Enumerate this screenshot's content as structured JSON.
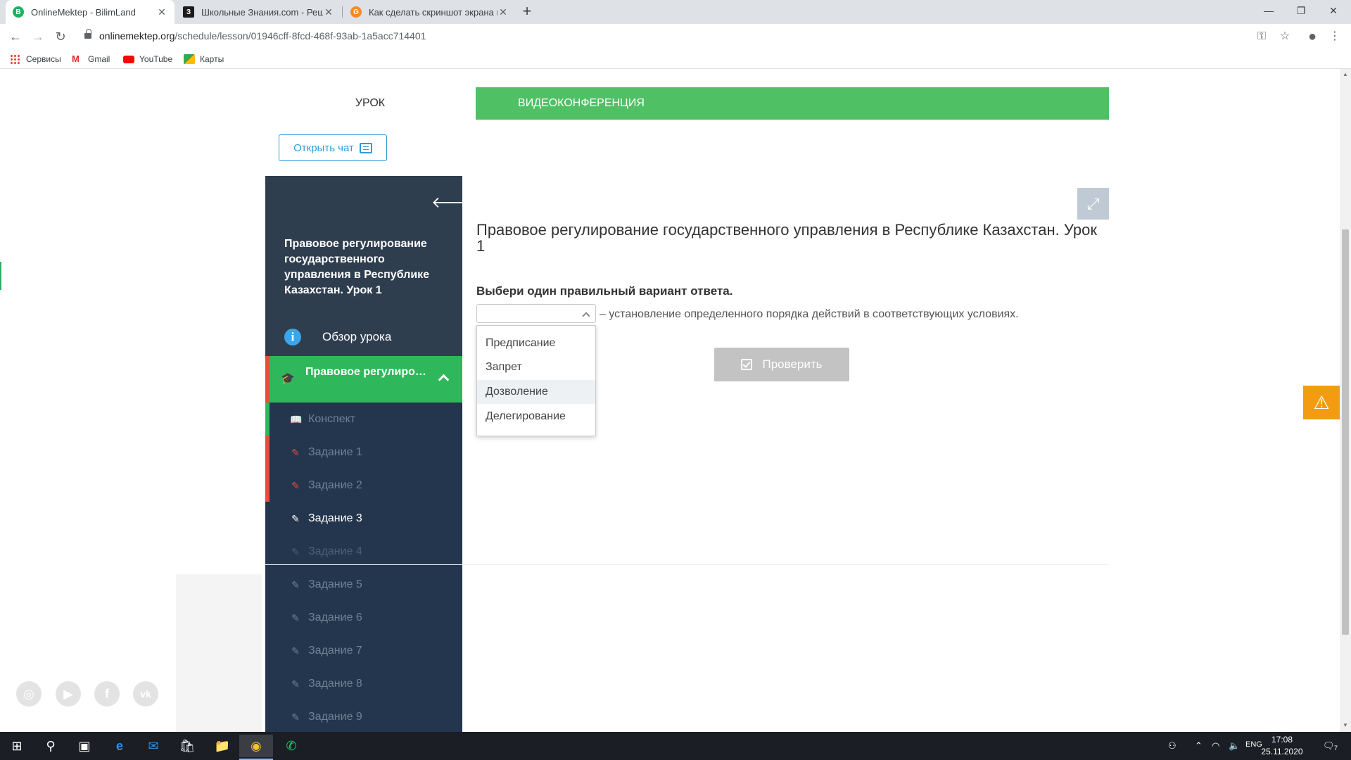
{
  "browser": {
    "tabs": [
      {
        "title": "OnlineMektep - BilimLand",
        "active": true,
        "favicon_color": "#27ae60",
        "favicon": "B"
      },
      {
        "title": "Школьные Знания.com - Решае",
        "active": false,
        "favicon_color": "#1b1b1b",
        "favicon": "З"
      },
      {
        "title": "Как сделать скриншот экрана н",
        "active": false,
        "favicon_color": "#f08c28",
        "favicon": "G"
      }
    ],
    "new_tab": "+",
    "url_domain": "onlinemektep.org",
    "url_path": "/schedule/lesson/01946cff-8fcd-468f-93ab-1a5acc714401",
    "bookmarks": [
      {
        "label": "Сервисы",
        "icon": "apps-grid-icon",
        "color": "#ea4335"
      },
      {
        "label": "Gmail",
        "icon": "gmail-icon",
        "color": "#d93025"
      },
      {
        "label": "YouTube",
        "icon": "youtube-icon",
        "color": "#ff0000"
      },
      {
        "label": "Карты",
        "icon": "maps-icon",
        "color": "#34a853"
      }
    ]
  },
  "lesson_tabs": {
    "lesson": "УРОК",
    "video": "ВИДЕОКОНФЕРЕНЦИЯ"
  },
  "chat_button": "Открыть чат",
  "sidebar": {
    "title": "Правовое регулирование государственного управления в Республике Казахстан. Урок 1",
    "overview": "Обзор урока",
    "section": "Правовое регулирование гос...",
    "items": [
      {
        "label": "Конспект",
        "state": "viewed",
        "icon": "book-icon"
      },
      {
        "label": "Задание 1",
        "state": "wrong",
        "icon": "edit-icon"
      },
      {
        "label": "Задание 2",
        "state": "wrong",
        "icon": "edit-icon"
      },
      {
        "label": "Задание 3",
        "state": "current",
        "icon": "edit-icon"
      },
      {
        "label": "Задание 4",
        "state": "pending",
        "icon": "edit-icon"
      },
      {
        "label": "Задание 5",
        "state": "pending",
        "icon": "edit-icon"
      },
      {
        "label": "Задание 6",
        "state": "pending",
        "icon": "edit-icon"
      },
      {
        "label": "Задание 7",
        "state": "pending",
        "icon": "edit-icon"
      },
      {
        "label": "Задание 8",
        "state": "pending",
        "icon": "edit-icon"
      },
      {
        "label": "Задание 9",
        "state": "pending",
        "icon": "edit-icon"
      }
    ]
  },
  "question": {
    "title": "Правовое регулирование государственного управления в Республике Казахстан. Урок 1",
    "instruction": "Выбери один правильный вариант ответа.",
    "sentence": "– установление определенного порядка действий в соответствующих условиях.",
    "selected": "",
    "options": [
      "Предписание",
      "Запрет",
      "Дозволение",
      "Делегирование"
    ],
    "highlighted_option": 2,
    "check_button": "Проверить"
  },
  "taskbar": {
    "language": "ENG",
    "time": "17:08",
    "date": "25.11.2020",
    "notifications": "7"
  },
  "colors": {
    "green": "#4fc063",
    "sidebar_dark": "#2c3e50",
    "accent_blue": "#2d9cdb",
    "warning": "#f39c12"
  }
}
